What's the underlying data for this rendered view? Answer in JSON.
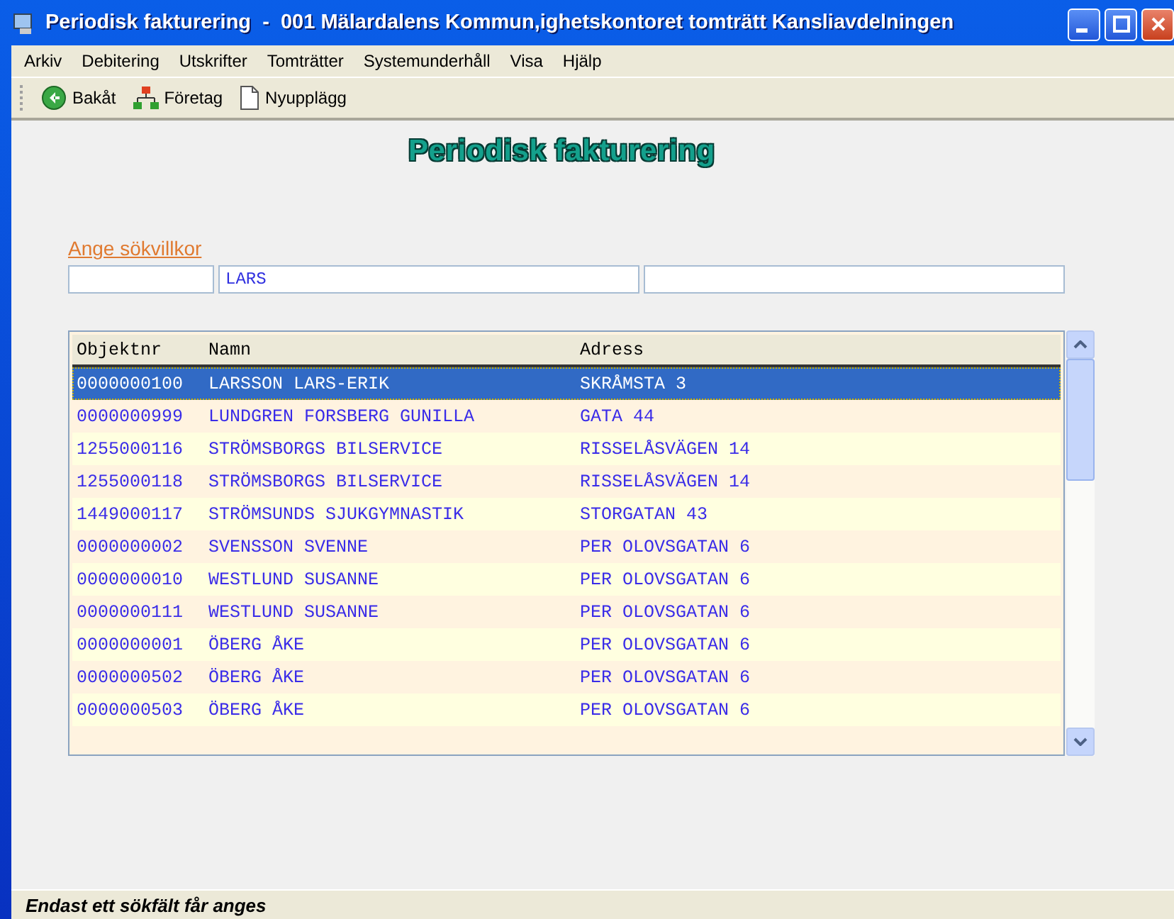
{
  "window": {
    "title": "Periodisk fakturering  -  001 Mälardalens Kommun,ighetskontoret tomträtt Kansliavdelningen"
  },
  "menu": [
    "Arkiv",
    "Debitering",
    "Utskrifter",
    "Tomträtter",
    "Systemunderhåll",
    "Visa",
    "Hjälp"
  ],
  "toolbar": [
    {
      "kind": "back",
      "label": "Bakåt"
    },
    {
      "kind": "company",
      "label": "Företag"
    },
    {
      "kind": "new",
      "label": "Nyupplägg"
    }
  ],
  "heading": "Periodisk fakturering",
  "search": {
    "label": "Ange sökvillkor",
    "fields": [
      {
        "kind": "empty"
      },
      {
        "kind": "filled",
        "value": "LARS"
      },
      {
        "kind": "empty"
      }
    ]
  },
  "table": {
    "columns": [
      "Objektnr",
      "Namn",
      "Adress"
    ],
    "rows": [
      {
        "cells": [
          "0000000100",
          "LARSSON LARS-ERIK",
          "SKRÅMSTA 3"
        ],
        "selected": true
      },
      {
        "cells": [
          "0000000999",
          "LUNDGREN FORSBERG GUNILLA",
          "GATA 44"
        ],
        "selected": false
      },
      {
        "cells": [
          "1255000116",
          "STRÖMSBORGS BILSERVICE",
          "RISSELÅSVÄGEN 14"
        ],
        "selected": false
      },
      {
        "cells": [
          "1255000118",
          "STRÖMSBORGS BILSERVICE",
          "RISSELÅSVÄGEN 14"
        ],
        "selected": false
      },
      {
        "cells": [
          "1449000117",
          "STRÖMSUNDS SJUKGYMNASTIK",
          "STORGATAN 43"
        ],
        "selected": false
      },
      {
        "cells": [
          "0000000002",
          "SVENSSON SVENNE",
          "PER OLOVSGATAN 6"
        ],
        "selected": false
      },
      {
        "cells": [
          "0000000010",
          "WESTLUND SUSANNE",
          "PER OLOVSGATAN 6"
        ],
        "selected": false
      },
      {
        "cells": [
          "0000000111",
          "WESTLUND SUSANNE",
          "PER OLOVSGATAN 6"
        ],
        "selected": false
      },
      {
        "cells": [
          "0000000001",
          "ÖBERG ÅKE",
          "PER OLOVSGATAN 6"
        ],
        "selected": false
      },
      {
        "cells": [
          "0000000502",
          "ÖBERG ÅKE",
          "PER OLOVSGATAN 6"
        ],
        "selected": false
      },
      {
        "cells": [
          "0000000503",
          "ÖBERG ÅKE",
          "PER OLOVSGATAN 6"
        ],
        "selected": false
      }
    ]
  },
  "status_bar": "Endast ett sökfält får anges"
}
